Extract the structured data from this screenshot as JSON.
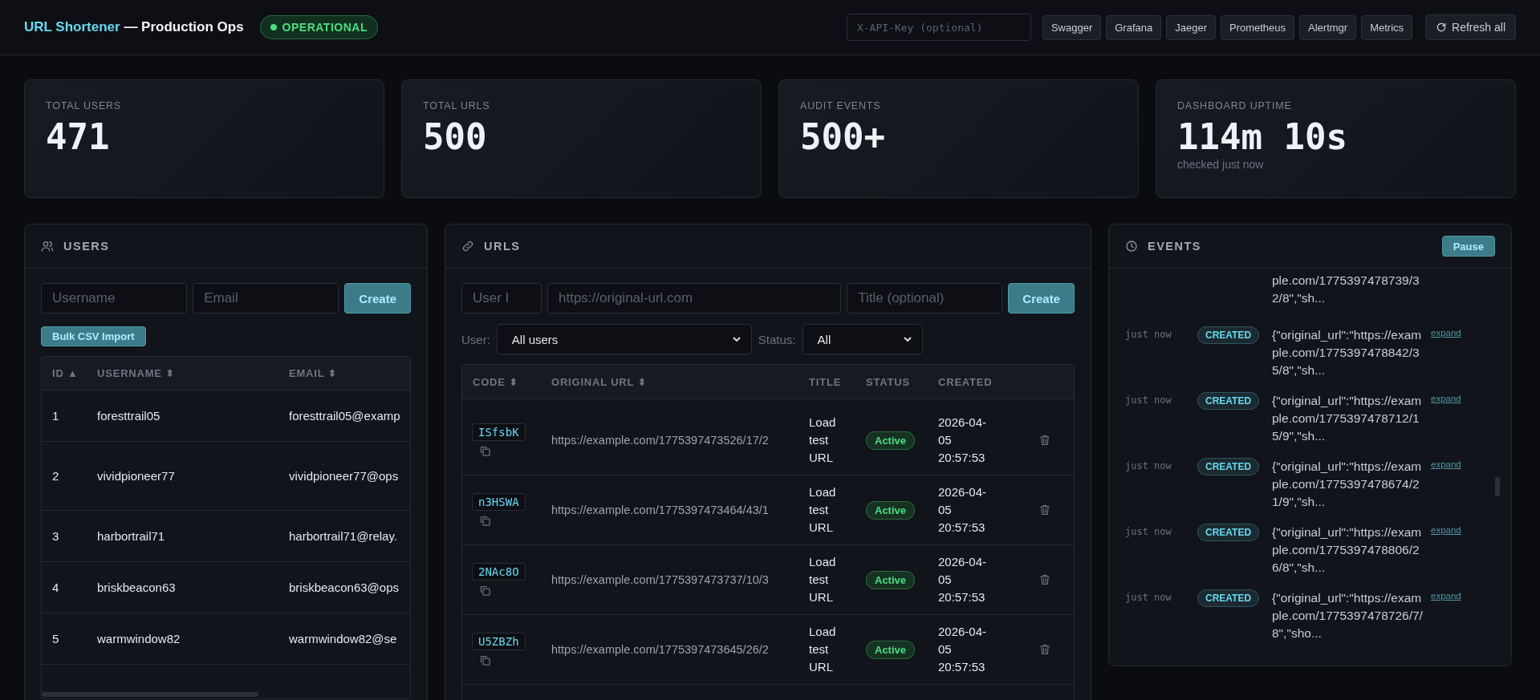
{
  "header": {
    "title_brand": "URL Shortener",
    "title_rest": " — Production Ops",
    "status": {
      "label": "OPERATIONAL",
      "healthy": true
    },
    "api_key": {
      "placeholder": "X-API-Key (optional)"
    },
    "links": [
      "Swagger",
      "Grafana",
      "Jaeger",
      "Prometheus",
      "Alertmgr",
      "Metrics"
    ],
    "refresh_button": "Refresh all"
  },
  "stats": [
    {
      "label": "TOTAL USERS",
      "value": "471"
    },
    {
      "label": "TOTAL URLS",
      "value": "500"
    },
    {
      "label": "AUDIT EVENTS",
      "value": "500+"
    },
    {
      "label": "DASHBOARD UPTIME",
      "value": "114m 10s",
      "note": "checked just now"
    }
  ],
  "users": {
    "title": "USERS",
    "username": {
      "placeholder": "Username"
    },
    "email": {
      "placeholder": "Email"
    },
    "create_button": "Create",
    "import_button": "Bulk CSV Import",
    "columns": [
      "ID ▲",
      "USERNAME ⬍",
      "EMAIL ⬍"
    ],
    "rows": [
      {
        "id": "1",
        "username": "foresttrail05",
        "email": "foresttrail05@examp"
      },
      {
        "id": "2",
        "username": "vividpioneer77",
        "email": "vividpioneer77@ops"
      },
      {
        "id": "3",
        "username": "harbortrail71",
        "email": "harbortrail71@relay."
      },
      {
        "id": "4",
        "username": "briskbeacon63",
        "email": "briskbeacon63@ops"
      },
      {
        "id": "5",
        "username": "warmwindow82",
        "email": "warmwindow82@se"
      }
    ]
  },
  "urls": {
    "title": "URLS",
    "user_id": {
      "placeholder": "User I"
    },
    "original_url": {
      "placeholder": "https://original-url.com"
    },
    "title_field": {
      "placeholder": "Title (optional)"
    },
    "create_button": "Create",
    "user_filter": {
      "label": "User:",
      "value": "All users"
    },
    "status_filter": {
      "label": "Status:",
      "value": "All"
    },
    "columns": [
      "CODE ⬍",
      "ORIGINAL URL ⬍",
      "TITLE",
      "STATUS",
      "CREATED"
    ],
    "rows": [
      {
        "code": "ISfsbK",
        "url": "https://example.com/1775397473526/17/2",
        "title": "Load test URL",
        "status": "Active",
        "created": "2026-04-05 20:57:53"
      },
      {
        "code": "n3HSWA",
        "url": "https://example.com/1775397473464/43/1",
        "title": "Load test URL",
        "status": "Active",
        "created": "2026-04-05 20:57:53"
      },
      {
        "code": "2NAc8O",
        "url": "https://example.com/1775397473737/10/3",
        "title": "Load test URL",
        "status": "Active",
        "created": "2026-04-05 20:57:53"
      },
      {
        "code": "U5ZBZh",
        "url": "https://example.com/1775397473645/26/2",
        "title": "Load test URL",
        "status": "Active",
        "created": "2026-04-05 20:57:53"
      }
    ]
  },
  "events": {
    "title": "EVENTS",
    "pause_button": "Pause",
    "items": [
      {
        "kind": "partial",
        "detail": "ple.com/1775397478739/32/8\",\"sh..."
      },
      {
        "kind": "full",
        "time": "just now",
        "type": "CREATED",
        "detail": "{\"original_url\":\"https://example.com/1775397478842/35/8\",\"sh...",
        "link": "expand"
      },
      {
        "kind": "full",
        "time": "just now",
        "type": "CREATED",
        "detail": "{\"original_url\":\"https://example.com/1775397478712/15/9\",\"sh...",
        "link": "expand"
      },
      {
        "kind": "full",
        "time": "just now",
        "type": "CREATED",
        "detail": "{\"original_url\":\"https://example.com/1775397478674/21/9\",\"sh...",
        "link": "expand"
      },
      {
        "kind": "full",
        "time": "just now",
        "type": "CREATED",
        "detail": "{\"original_url\":\"https://example.com/1775397478806/26/8\",\"sh...",
        "link": "expand"
      },
      {
        "kind": "full",
        "time": "just now",
        "type": "CREATED",
        "detail": "{\"original_url\":\"https://example.com/1775397478726/7/8\",\"sho...",
        "link": "expand"
      }
    ]
  }
}
